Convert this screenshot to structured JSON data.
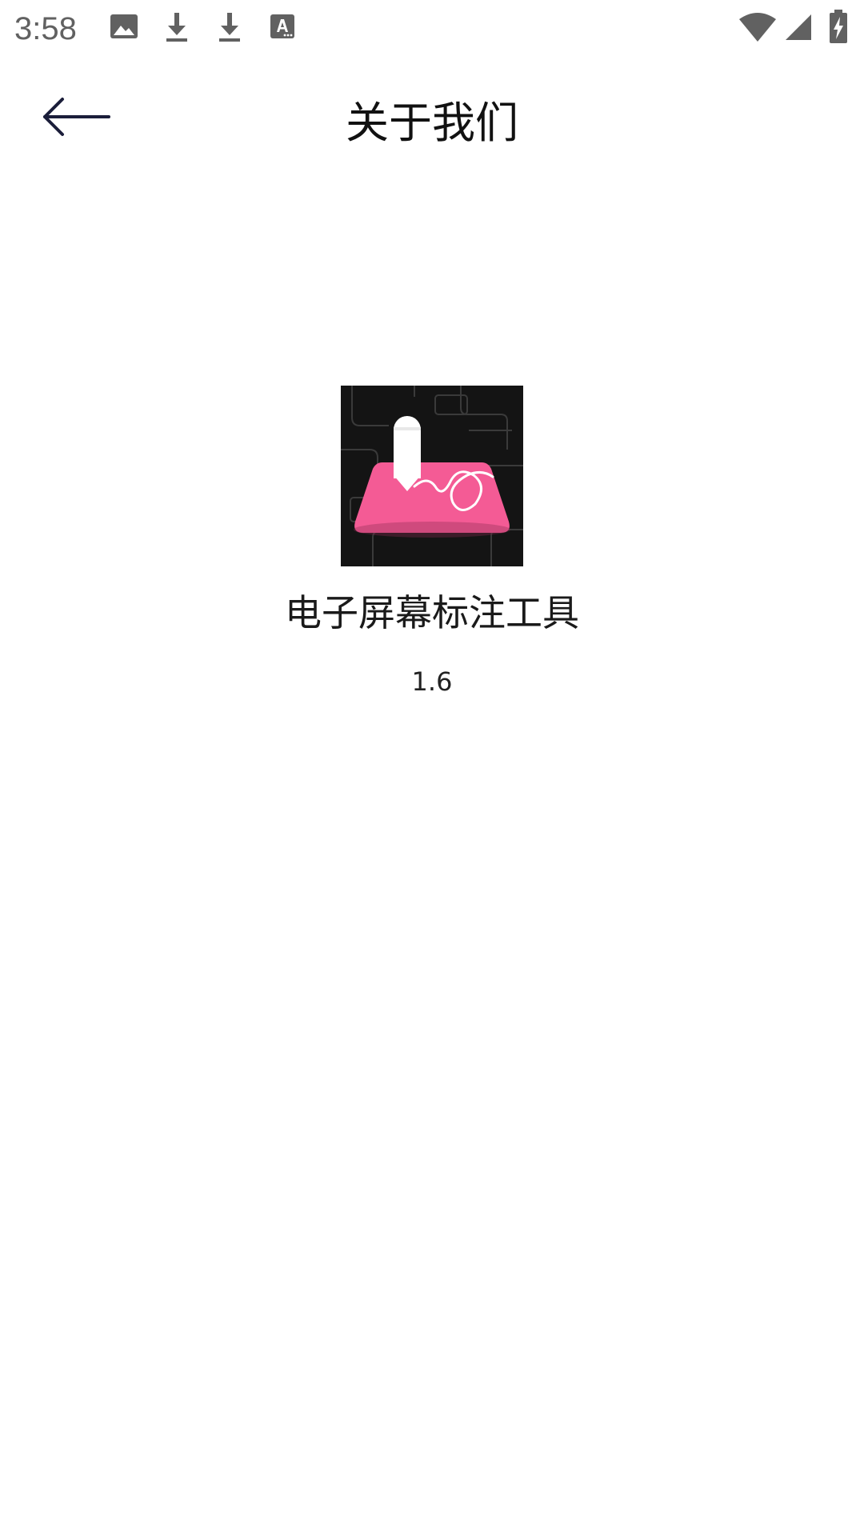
{
  "status_bar": {
    "time": "3:58",
    "icons": [
      "image-icon",
      "download-icon",
      "download-icon",
      "font-a-icon",
      "wifi-icon",
      "cell-signal-icon",
      "battery-charging-icon"
    ]
  },
  "app_bar": {
    "back_icon": "arrow-left-icon",
    "title": "关于我们"
  },
  "about": {
    "app_name": "电子屏幕标注工具",
    "version": "1.6"
  },
  "colors": {
    "logo_background": "#141414",
    "logo_accent": "#F45B95",
    "back_arrow": "#1B1E3A"
  }
}
